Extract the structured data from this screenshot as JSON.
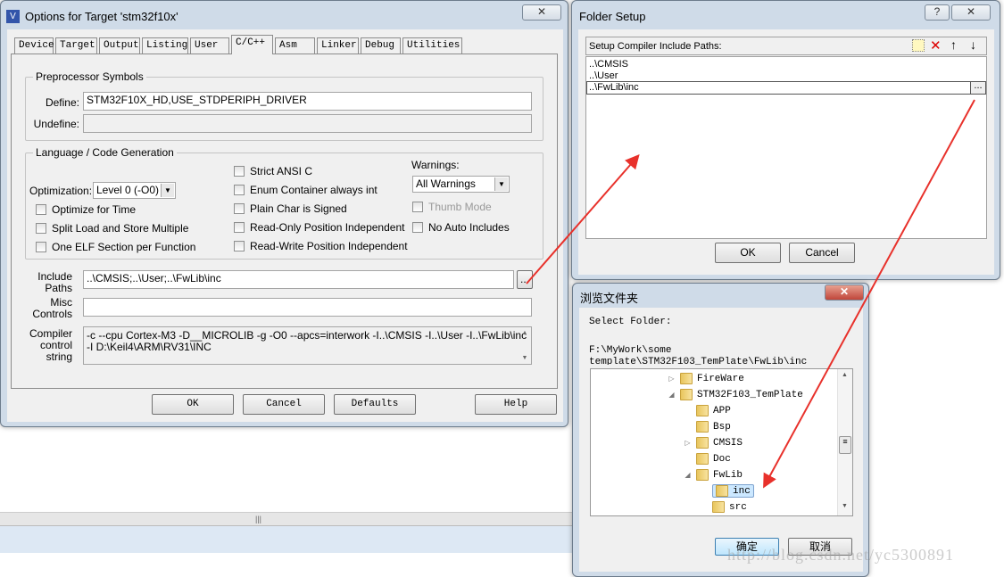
{
  "main_dialog": {
    "title": "Options for Target 'stm32f10x'",
    "close_icon": "close-icon",
    "tabs": [
      {
        "label": "Device"
      },
      {
        "label": "Target"
      },
      {
        "label": "Output"
      },
      {
        "label": "Listing"
      },
      {
        "label": "User"
      },
      {
        "label": "C/C++",
        "active": true
      },
      {
        "label": "Asm"
      },
      {
        "label": "Linker"
      },
      {
        "label": "Debug"
      },
      {
        "label": "Utilities"
      }
    ],
    "preprocessor": {
      "group_label": "Preprocessor Symbols",
      "define_label": "Define:",
      "define_value": "STM32F10X_HD,USE_STDPERIPH_DRIVER",
      "undefine_label": "Undefine:",
      "undefine_value": ""
    },
    "language": {
      "group_label": "Language / Code Generation",
      "optimization_label": "Optimization:",
      "optimization_value": "Level 0 (-O0)",
      "checkboxes": [
        {
          "label": "Optimize for Time",
          "checked": false
        },
        {
          "label": "Split Load and Store Multiple",
          "checked": false
        },
        {
          "label": "One ELF Section per Function",
          "checked": false
        },
        {
          "label": "Strict ANSI C",
          "checked": false
        },
        {
          "label": "Enum Container always int",
          "checked": false
        },
        {
          "label": "Plain Char is Signed",
          "checked": false
        },
        {
          "label": "Read-Only Position Independent",
          "checked": false
        },
        {
          "label": "Read-Write Position Independent",
          "checked": false
        },
        {
          "label": "Thumb Mode",
          "checked": false,
          "disabled": true
        },
        {
          "label": "No Auto Includes",
          "checked": false
        }
      ],
      "warnings_label": "Warnings:",
      "warnings_value": "All Warnings"
    },
    "include_paths_label": "Include Paths",
    "include_paths_value": "..\\CMSIS;..\\User;..\\FwLib\\inc",
    "browse_label": "...",
    "misc_controls_label": "Misc Controls",
    "misc_controls_value": "",
    "compiler_label": "Compiler control string",
    "compiler_line1": "-c --cpu Cortex-M3 -D__MICROLIB -g -O0 --apcs=interwork -I..\\CMSIS -I..\\User -I..\\FwLib\\inc",
    "compiler_line2": "-I D:\\Keil4\\ARM\\RV31\\INC",
    "buttons": {
      "ok": "OK",
      "cancel": "Cancel",
      "defaults": "Defaults",
      "help": "Help"
    }
  },
  "folder_setup": {
    "title": "Folder Setup",
    "help_label": "?",
    "header_label": "Setup Compiler Include Paths:",
    "toolbar_icons": [
      "new-folder-icon",
      "delete-icon",
      "move-up-icon",
      "move-down-icon"
    ],
    "paths": [
      "..\\CMSIS",
      "..\\User",
      "..\\FwLib\\inc"
    ],
    "browse_label": "...",
    "ok": "OK",
    "cancel": "Cancel"
  },
  "browse_dialog": {
    "title": "浏览文件夹",
    "prompt": "Select Folder:",
    "path_line1": "F:\\MyWork\\some",
    "path_line2": "template\\STM32F103_TemPlate\\FwLib\\inc",
    "tree": [
      {
        "label": "FireWare",
        "level": 0,
        "expander": "collapsed"
      },
      {
        "label": "STM32F103_TemPlate",
        "level": 0,
        "expander": "expanded"
      },
      {
        "label": "APP",
        "level": 1,
        "expander": "none"
      },
      {
        "label": "Bsp",
        "level": 1,
        "expander": "none"
      },
      {
        "label": "CMSIS",
        "level": 1,
        "expander": "collapsed"
      },
      {
        "label": "Doc",
        "level": 1,
        "expander": "none"
      },
      {
        "label": "FwLib",
        "level": 1,
        "expander": "expanded"
      },
      {
        "label": "inc",
        "level": 2,
        "expander": "none",
        "selected": true
      },
      {
        "label": "src",
        "level": 2,
        "expander": "none"
      }
    ],
    "ok": "确定",
    "cancel": "取消"
  },
  "watermark": "http://blog.csdn.net/yc5300891",
  "colors": {
    "arrow": "#e8312b",
    "selection": "#cce8ff"
  }
}
